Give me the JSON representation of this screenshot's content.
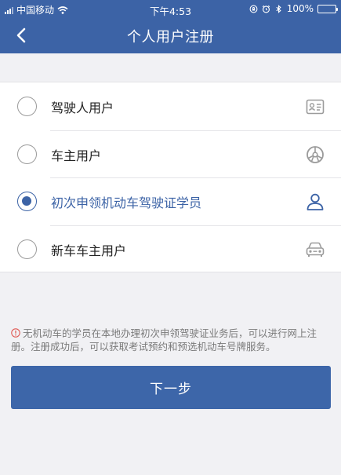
{
  "status_bar": {
    "carrier": "中国移动",
    "time": "下午4:53",
    "battery": "100%"
  },
  "nav": {
    "title": "个人用户注册",
    "back_icon": "chevron-left-icon"
  },
  "options": [
    {
      "label": "驾驶人用户",
      "selected": false,
      "icon": "license-card-icon"
    },
    {
      "label": "车主用户",
      "selected": false,
      "icon": "steering-wheel-icon"
    },
    {
      "label": "初次申领机动车驾驶证学员",
      "selected": true,
      "icon": "person-icon"
    },
    {
      "label": "新车车主用户",
      "selected": false,
      "icon": "car-front-icon"
    }
  ],
  "notice": {
    "text": "无机动车的学员在本地办理初次申领驾驶证业务后，可以进行网上注册。注册成功后，可以获取考试预约和预选机动车号牌服务。"
  },
  "next_button": {
    "label": "下一步"
  },
  "colors": {
    "primary": "#3c63a6",
    "warning": "#e05a55",
    "icon_gray": "#9b9b9b"
  }
}
